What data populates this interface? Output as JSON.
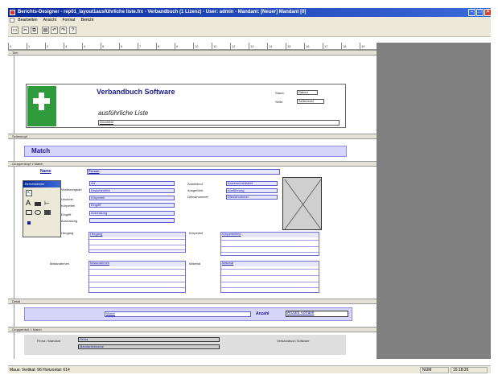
{
  "window": {
    "title": "Berichts-Designer - rep01_layout1ausführliche liste.frx - Verbandbuch (1 Lizenz) - User: admin - Mandant: [Neuer] Mandant [0]"
  },
  "menu": [
    "Bearbeiten",
    "Ansicht",
    "Format",
    "Bericht"
  ],
  "toolbar": {
    "icons": [
      "new-doc-icon",
      "cut-icon",
      "copy-icon",
      "paste-icon",
      "undo-icon",
      "redo-icon",
      "help-icon"
    ]
  },
  "ruler": {
    "ticks": [
      "0",
      "1",
      "2",
      "3",
      "4",
      "5",
      "6",
      "7",
      "8",
      "9",
      "10",
      "11",
      "12",
      "13",
      "14",
      "15",
      "16",
      "17",
      "18",
      "19"
    ]
  },
  "bands": {
    "title": "Titel",
    "page_header": "Seitenkopf",
    "group_header": "Gruppenkopf 1 Match",
    "detail": "Detail",
    "group_footer": "Gruppenfuß 1 Match"
  },
  "title_band": {
    "heading": "Verbandbuch Software",
    "subheading": "ausführliche Liste",
    "placeholder_field": "Druckfeld",
    "stand_label": "Stand:",
    "stand_value": "Datum",
    "seite_label": "Seite:",
    "seite_value": "Seitenzahl"
  },
  "page_header": {
    "match_label": "Match"
  },
  "group_header": {
    "name_label": "Name",
    "person_field": "Person",
    "left_labels": [
      "Verletzungsart",
      "Ursache",
      "Körperteil",
      "Eingriff",
      "Ausrüstung"
    ],
    "left_fields": [
      "Art",
      "Ursachenfeld",
      "Körperteil",
      "Eingriff",
      "Ausrüstung"
    ],
    "middle_labels": [
      "Anwesend",
      "Ausgeführt",
      "Dienstnummer"
    ],
    "middle_fields": [
      "Anwesenheitsfeld",
      "Ausführung",
      "Dienstnummer"
    ],
    "hergang_label": "Hergang",
    "hergang_field": "Hergang",
    "koerperteil_label": "Körperteil",
    "koerperteil_field": "Körperteilfeld",
    "massnahmen_label": "Massnahmen",
    "massnahmen_field": "Massnahmen",
    "material_label": "Material",
    "material_field": "Material"
  },
  "detail_band": {
    "match_field": "Match",
    "anzahl_label": "Anzahl",
    "anzahl_field": "Anzahl Vorfälle"
  },
  "group_footer": {
    "label": "Firma / Mandant",
    "fields": [
      "Firma",
      "Mandantenname"
    ],
    "right_label": "Verbandbuch Software"
  },
  "toolbox": {
    "title": "Berichtsfelder",
    "tools": [
      "pointer-icon",
      "text-tool-icon",
      "field-tool-icon",
      "line-tool-icon",
      "rect-tool-icon",
      "ellipse-tool-icon",
      "image-tool-icon",
      "barcode-tool-icon"
    ]
  },
  "statusbar": {
    "left": "Maus: Vertikal: 96 Horizontal: 614",
    "right_1": "NUM",
    "right_2": "15:18:26"
  }
}
